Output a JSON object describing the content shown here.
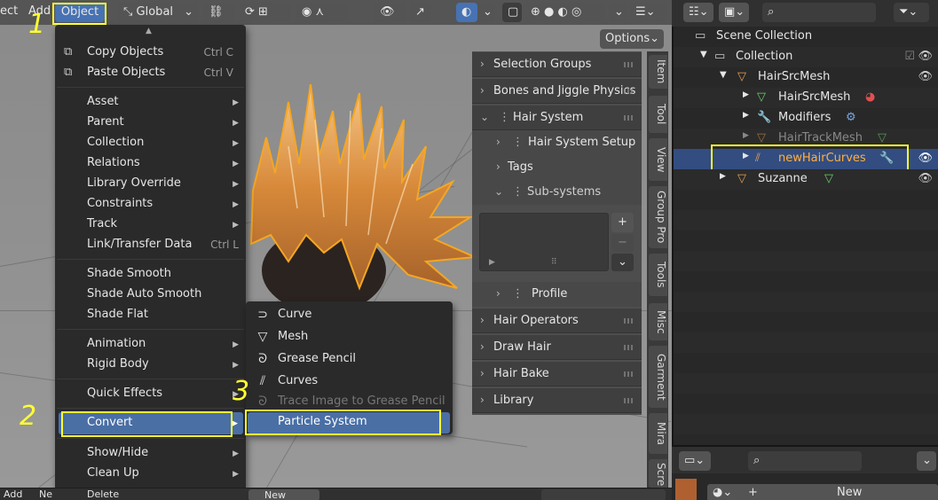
{
  "header": {
    "menu_left_partial": "ect",
    "menu_add": "Add",
    "menu_object": "Object",
    "transform_orientation": "Global",
    "options_label": "Options"
  },
  "object_menu": {
    "top_arrow": "▲",
    "items": [
      {
        "label": "Copy Objects",
        "shortcut": "Ctrl C"
      },
      {
        "label": "Paste Objects",
        "shortcut": "Ctrl V"
      },
      {
        "label": "Asset"
      },
      {
        "label": "Parent"
      },
      {
        "label": "Collection"
      },
      {
        "label": "Relations"
      },
      {
        "label": "Library Override"
      },
      {
        "label": "Constraints"
      },
      {
        "label": "Track"
      },
      {
        "label": "Link/Transfer Data",
        "shortcut": "Ctrl L"
      },
      {
        "label": "Shade Smooth"
      },
      {
        "label": "Shade Auto Smooth"
      },
      {
        "label": "Shade Flat"
      },
      {
        "label": "Animation"
      },
      {
        "label": "Rigid Body"
      },
      {
        "label": "Quick Effects"
      },
      {
        "label": "Convert"
      },
      {
        "label": "Show/Hide"
      },
      {
        "label": "Clean Up"
      },
      {
        "label": "Delete"
      }
    ]
  },
  "convert_menu": {
    "items": [
      {
        "label": "Curve",
        "icon": "curve-icon"
      },
      {
        "label": "Mesh",
        "icon": "mesh-icon"
      },
      {
        "label": "Grease Pencil",
        "icon": "grease-pencil-icon"
      },
      {
        "label": "Curves",
        "icon": "curves-icon"
      },
      {
        "label": "Trace Image to Grease Pencil",
        "icon": "grease-pencil-icon"
      },
      {
        "label": "Particle System",
        "icon": ""
      }
    ]
  },
  "annotations": {
    "step1": "1",
    "step2": "2",
    "step3": "3"
  },
  "npanel": {
    "selection_groups": "Selection Groups",
    "bones_jiggle": "Bones and Jiggle Physics",
    "hair_system": "Hair System",
    "hair_system_setup": "Hair System Setup",
    "tags": "Tags",
    "sub_systems": "Sub-systems",
    "profile": "Profile",
    "hair_operators": "Hair Operators",
    "draw_hair": "Draw Hair",
    "hair_bake": "Hair Bake",
    "library": "Library",
    "plus": "+",
    "minus": "−"
  },
  "side_tabs": [
    "Item",
    "Tool",
    "View",
    "Group Pro",
    "Tools",
    "Misc",
    "Garment",
    "Mira",
    "Scre"
  ],
  "outliner": {
    "rows": [
      {
        "label": "Scene Collection"
      },
      {
        "label": "Collection"
      },
      {
        "label": "HairSrcMesh"
      },
      {
        "label": "HairSrcMesh"
      },
      {
        "label": "Modifiers"
      },
      {
        "label": "HairTrackMesh"
      },
      {
        "label": "newHairCurves"
      },
      {
        "label": "Suzanne"
      }
    ]
  },
  "properties": {
    "new_label": "New"
  },
  "timeline": {
    "add": "Add",
    "partial": "Ne",
    "new": "New",
    "delete_partial": "Delete"
  },
  "colors": {
    "accent": "#4772b3",
    "annotation": "#ffff33",
    "selection": "#4a6fa5",
    "hair": "#e8a050"
  }
}
